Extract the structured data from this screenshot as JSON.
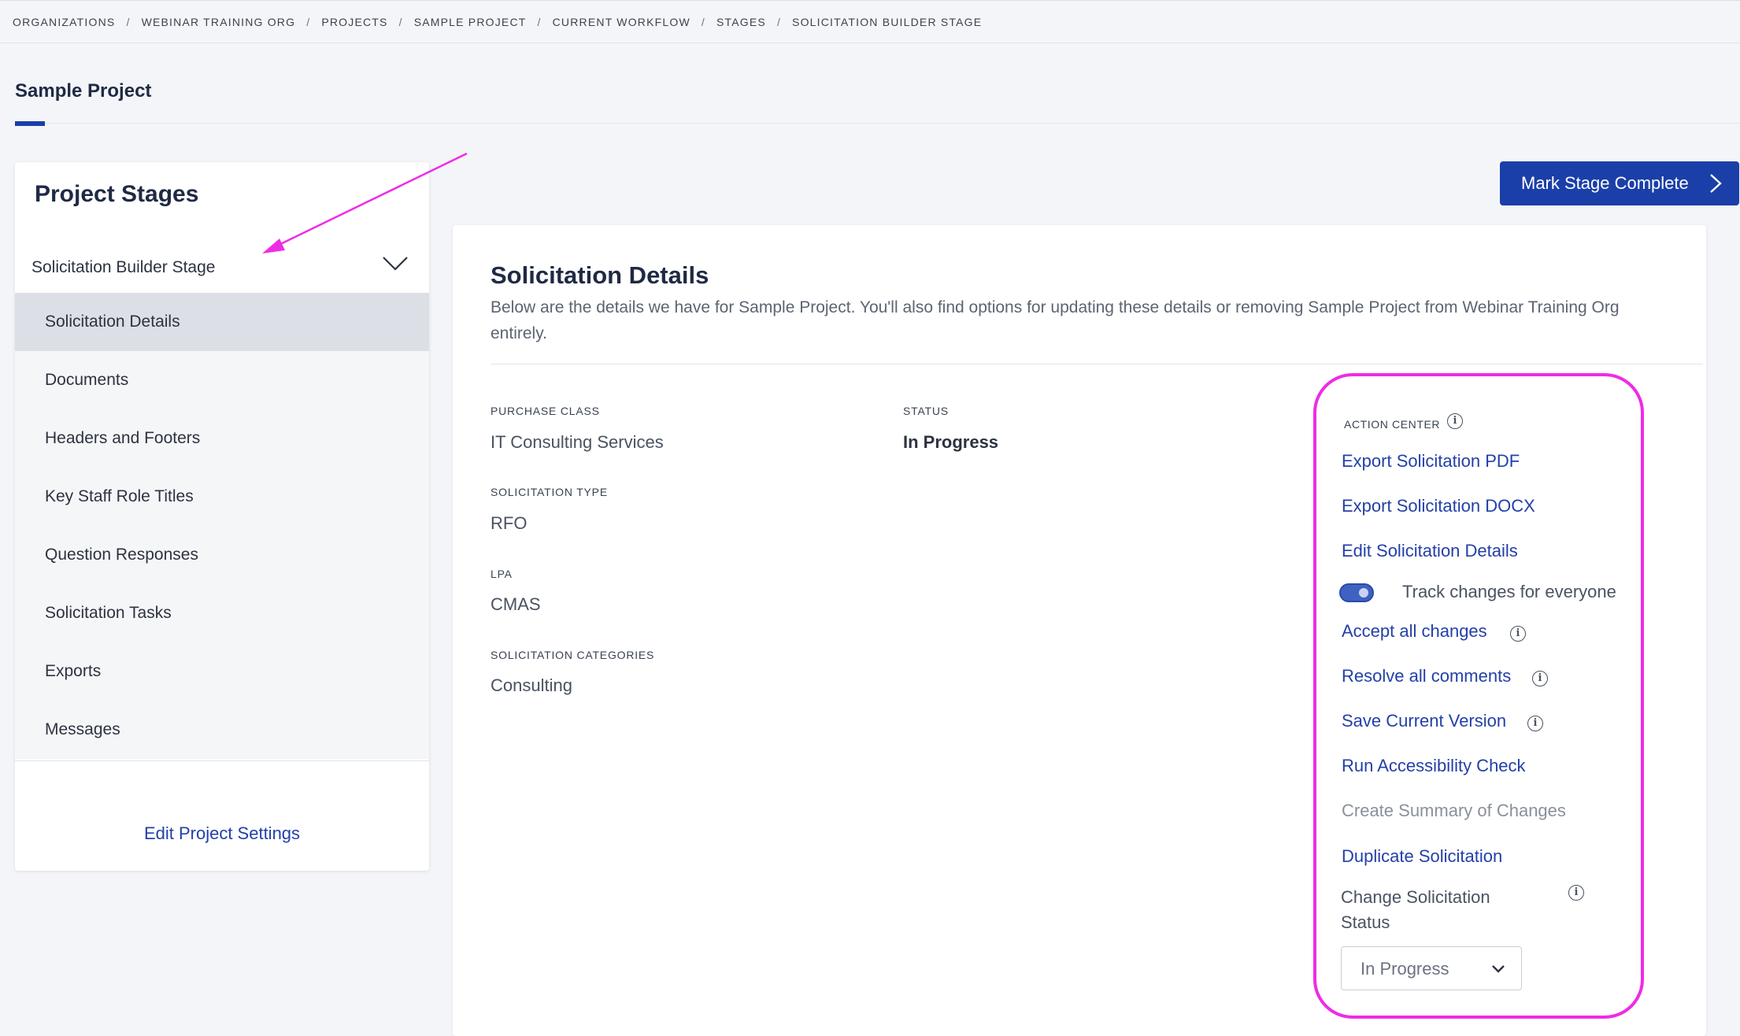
{
  "breadcrumb": [
    "ORGANIZATIONS",
    "WEBINAR TRAINING ORG",
    "PROJECTS",
    "SAMPLE PROJECT",
    "CURRENT WORKFLOW",
    "STAGES",
    "SOLICITATION BUILDER STAGE"
  ],
  "project": {
    "title": "Sample Project"
  },
  "stages_panel": {
    "title": "Project Stages",
    "current_stage": "Solicitation Builder Stage",
    "items": [
      "Solicitation Details",
      "Documents",
      "Headers and Footers",
      "Key Staff Role Titles",
      "Question Responses",
      "Solicitation Tasks",
      "Exports",
      "Messages"
    ],
    "active_item": "Solicitation Details",
    "edit_settings": "Edit Project Settings"
  },
  "mark_complete": {
    "label": "Mark Stage Complete"
  },
  "details": {
    "title": "Solicitation Details",
    "description": "Below are the details we have for Sample Project. You'll also find options for updating these details or removing Sample Project from Webinar Training Org entirely.",
    "fields": {
      "purchase_class": {
        "label": "PURCHASE CLASS",
        "value": "IT Consulting Services"
      },
      "status": {
        "label": "STATUS",
        "value": "In Progress"
      },
      "solicitation_type": {
        "label": "SOLICITATION TYPE",
        "value": "RFO"
      },
      "lpa": {
        "label": "LPA",
        "value": "CMAS"
      },
      "solicitation_categories": {
        "label": "SOLICITATION CATEGORIES",
        "value": "Consulting"
      }
    }
  },
  "action_center": {
    "label": "ACTION CENTER",
    "export_pdf": "Export Solicitation PDF",
    "export_docx": "Export Solicitation DOCX",
    "edit_details": "Edit Solicitation Details",
    "track_changes": {
      "label": "Track changes for everyone",
      "enabled": true
    },
    "accept_changes": "Accept all changes",
    "resolve_comments": "Resolve all comments",
    "save_version": "Save Current Version",
    "accessibility_check": "Run Accessibility Check",
    "summary_changes": "Create Summary of Changes",
    "duplicate": "Duplicate Solicitation",
    "change_status_label": "Change Solicitation Status",
    "status_select": "In Progress"
  },
  "colors": {
    "primary": "#1b3fa8",
    "link": "#2340a8",
    "annotation": "#ee2ce6"
  },
  "info_glyph": "i"
}
